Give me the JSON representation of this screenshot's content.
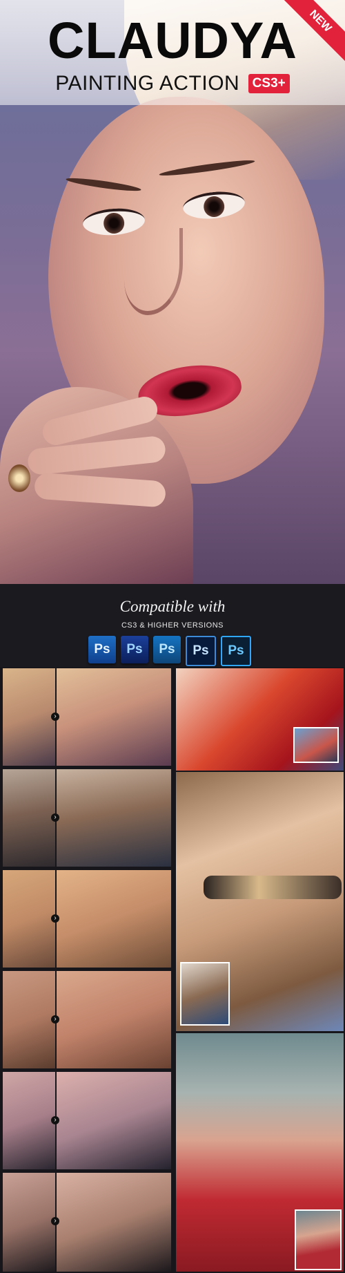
{
  "product": {
    "title": "CLAUDYA",
    "subtitle": "PAINTING ACTION",
    "version_badge": "CS3+",
    "ribbon": "NEW"
  },
  "compatibility": {
    "heading": "Compatible with",
    "subheading": "CS3 & HIGHER VERSIONS",
    "icons": [
      "Ps",
      "Ps",
      "Ps",
      "Ps",
      "Ps"
    ]
  },
  "colors": {
    "accent": "#e2213a",
    "dark_background": "#1a1a1f"
  }
}
